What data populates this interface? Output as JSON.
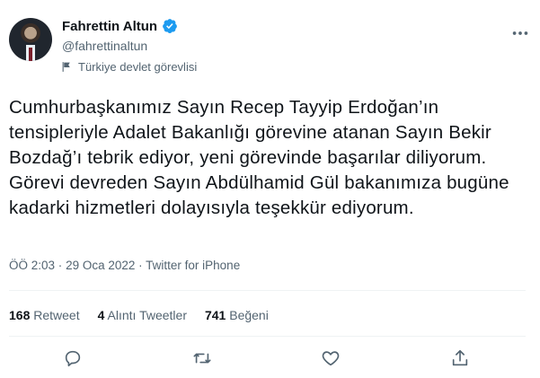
{
  "author": {
    "name": "Fahrettin Altun",
    "handle": "@fahrettinaltun",
    "label": "Türkiye devlet görevlisi"
  },
  "tweet": {
    "text": "Cumhurbaşkanımız Sayın Recep Tayyip Erdoğan’ın tensipleriyle Adalet Bakanlığı görevine atanan Sayın Bekir Bozdağ’ı tebrik ediyor, yeni görevinde başarılar diliyorum. Görevi devreden Sayın Abdülhamid Gül bakanımıza bugüne kadarki hizmetleri dolayısıyla teşekkür ediyorum.",
    "time": "ÖÖ 2:03",
    "date": "29 Oca 2022",
    "source": "Twitter for iPhone",
    "separator": "·"
  },
  "stats": {
    "retweets_count": "168",
    "retweets_label": "Retweet",
    "quotes_count": "4",
    "quotes_label": "Alıntı Tweetler",
    "likes_count": "741",
    "likes_label": "Beğeni"
  },
  "icons": {
    "verified": "verified-badge-icon",
    "label": "flag-icon",
    "more": "more-icon",
    "reply": "reply-icon",
    "retweet": "retweet-icon",
    "like": "heart-icon",
    "share": "share-icon"
  },
  "colors": {
    "verified_blue": "#1d9bf0",
    "secondary_text": "#536471",
    "divider": "#eff3f4"
  }
}
